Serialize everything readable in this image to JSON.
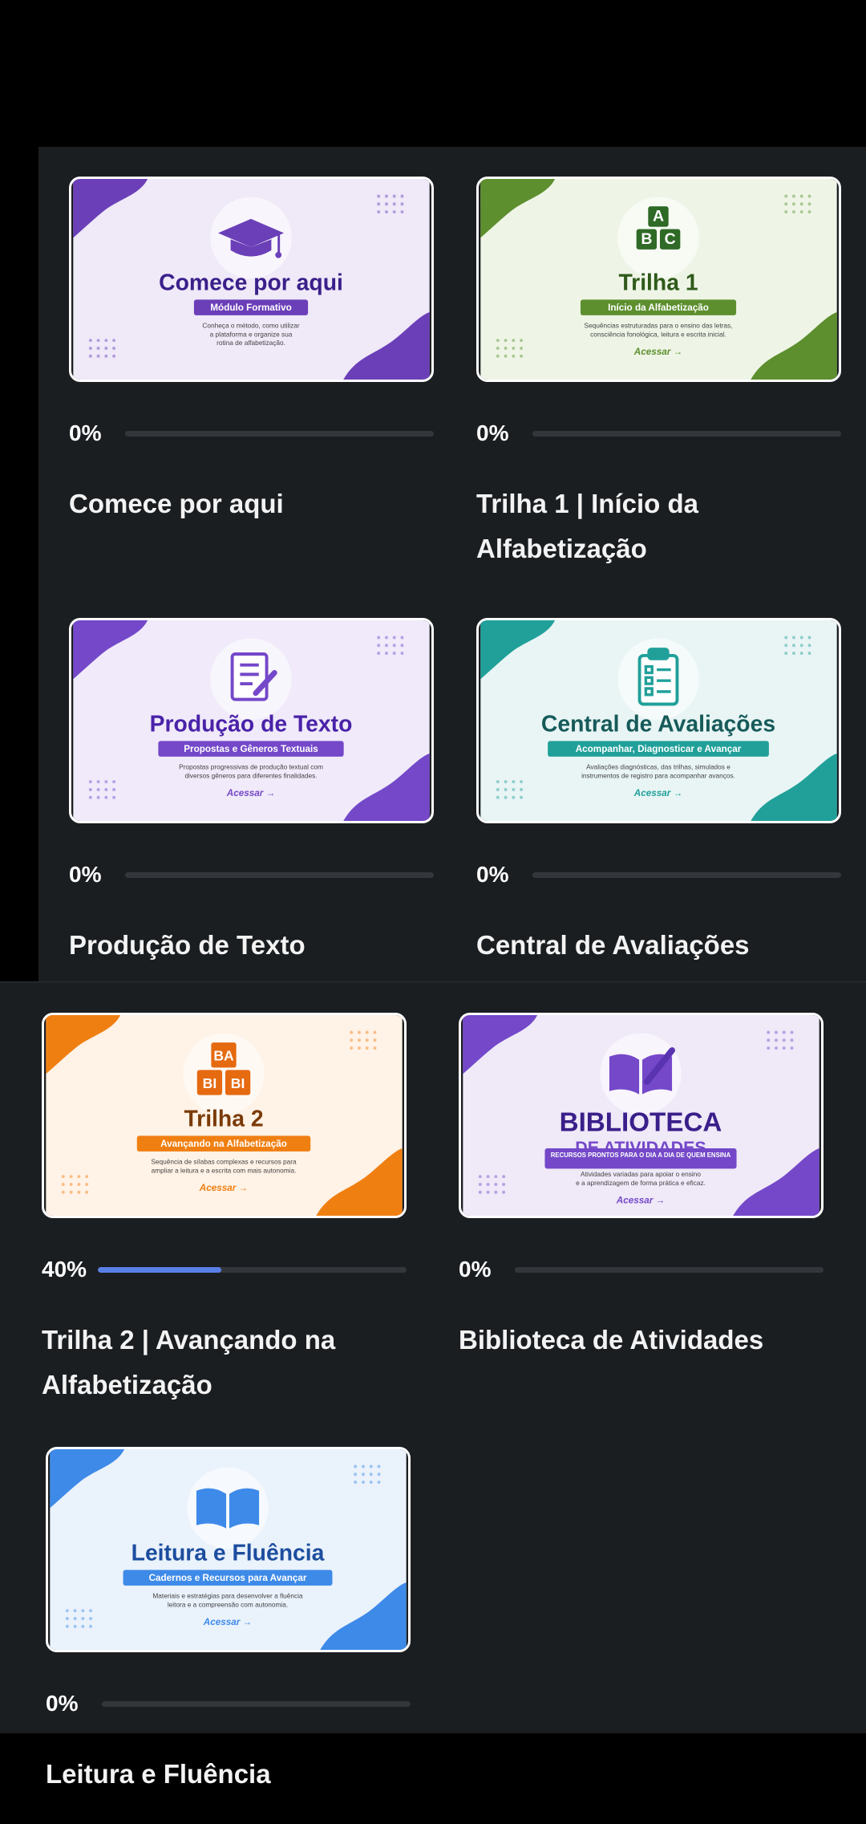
{
  "courses": [
    {
      "title": "Comece por aqui",
      "progress_label": "0%",
      "progress": 0,
      "thumb": {
        "heading": "Comece por aqui",
        "badge": "Módulo Formativo",
        "desc1": "Conheça o método, como utilizar",
        "desc2": "a plataforma e organize sua",
        "desc3": "rotina de alfabetização.",
        "cta": "",
        "icon": "graduation-cap-icon",
        "accent": "#6b3fb8",
        "bg": "#efe9f8",
        "heading_color": "#3a1f8a"
      }
    },
    {
      "title": "Trilha 1 | Início da Alfabetização",
      "progress_label": "0%",
      "progress": 0,
      "thumb": {
        "heading": "Trilha 1",
        "badge": "Início da Alfabetização",
        "desc1": "Sequências estruturadas para o ensino das letras,",
        "desc2": "consciência fonológica, leitura e escrita inicial.",
        "desc3": "",
        "cta": "Acessar →",
        "icon": "abc-blocks-icon",
        "accent": "#5d8f2e",
        "bg": "#eef5e6",
        "heading_color": "#2f5a1a",
        "blocks": [
          "A",
          "B",
          "C"
        ]
      }
    },
    {
      "title": "Produção de Texto",
      "progress_label": "0%",
      "progress": 0,
      "thumb": {
        "heading": "Produção de Texto",
        "badge": "Propostas e Gêneros Textuais",
        "desc1": "Propostas progressivas de produção textual com",
        "desc2": "diversos gêneros para diferentes finalidades.",
        "desc3": "",
        "cta": "Acessar →",
        "icon": "document-pencil-icon",
        "accent": "#7448c9",
        "bg": "#f0eafa",
        "heading_color": "#4a22a8"
      }
    },
    {
      "title": "Central de Avaliações",
      "progress_label": "0%",
      "progress": 0,
      "thumb": {
        "heading": "Central de Avaliações",
        "badge": "Acompanhar, Diagnosticar e Avançar",
        "desc1": "Avaliações diagnósticas, das trilhas, simulados e",
        "desc2": "instrumentos de registro para acompanhar avanços.",
        "desc3": "",
        "cta": "Acessar →",
        "icon": "clipboard-checklist-icon",
        "accent": "#21a09a",
        "bg": "#e8f5f4",
        "heading_color": "#175a5a"
      }
    },
    {
      "title": "Trilha 2 | Avançando na Alfabetização",
      "progress_label": "40%",
      "progress": 0.4,
      "thumb": {
        "heading": "Trilha 2",
        "badge": "Avançando na Alfabetização",
        "desc1": "Sequência de sílabas complexas e recursos para",
        "desc2": "ampliar a leitura e a escrita com mais autonomia.",
        "desc3": "",
        "cta": "Acessar →",
        "icon": "syllable-blocks-icon",
        "accent": "#f07f12",
        "bg": "#fff2e6",
        "heading_color": "#7a3a08",
        "blocks": [
          "BA",
          "BI",
          "BI"
        ]
      }
    },
    {
      "title": "Biblioteca de Atividades",
      "progress_label": "0%",
      "progress": 0,
      "thumb": {
        "heading": "BIBLIOTECA",
        "heading2": "DE ATIVIDADES",
        "badge": "RECURSOS PRONTOS PARA O DIA A DIA DE QUEM ENSINA",
        "desc1": "Atividades variadas para apoiar o ensino",
        "desc2": "e a aprendizagem de forma prática e eficaz.",
        "desc3": "",
        "cta": "Acessar →",
        "icon": "open-book-pencil-icon",
        "accent": "#7448c9",
        "bg": "#efe9f8",
        "heading_color": "#3a1f8a"
      }
    },
    {
      "title": "Leitura e Fluência",
      "progress_label": "0%",
      "progress": 0,
      "thumb": {
        "heading": "Leitura e Fluência",
        "badge": "Cadernos e Recursos para Avançar",
        "desc1": "Materiais e estratégias para desenvolver a fluência",
        "desc2": "leitora e a compreensão com autonomia.",
        "desc3": "",
        "cta": "Acessar →",
        "icon": "open-book-icon",
        "accent": "#3d8ae8",
        "bg": "#eaf2fc",
        "heading_color": "#1c4d9e"
      }
    }
  ]
}
